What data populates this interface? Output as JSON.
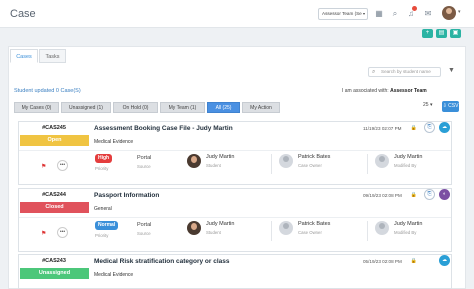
{
  "app": {
    "title": "Case"
  },
  "header": {
    "team_select": "Assessor Team (Se",
    "icons": [
      "calendar-icon",
      "search-icon",
      "bell-icon",
      "chat-icon",
      "avatar"
    ]
  },
  "tabs": [
    {
      "label": "Cases",
      "active": true
    },
    {
      "label": "Tasks",
      "active": false
    }
  ],
  "toolbar": {
    "search_placeholder": "Search by student name"
  },
  "status_line": {
    "updated": "Student updated 0 Case(S)",
    "associated_prefix": "I am associated with:",
    "associated_team": "Assessor Team"
  },
  "filters": [
    {
      "label": "My Cases (0)",
      "active": false
    },
    {
      "label": "Unassigned (1)",
      "active": false
    },
    {
      "label": "On Hold (0)",
      "active": false
    },
    {
      "label": "My Team (1)",
      "active": false
    },
    {
      "label": "All (25)",
      "active": true
    },
    {
      "label": "My Action",
      "active": false
    }
  ],
  "pagination": {
    "page_size": "25",
    "export_label": "CSV"
  },
  "cases": [
    {
      "id": "#CAS245",
      "status": "Open",
      "status_color": "#f0c442",
      "title": "Assessment Booking Case File - Judy Martin",
      "category": "Medical Evidence",
      "date": "11/19/23 02:07 PM",
      "priority": "High",
      "priority_color": "#e43d3d",
      "priority_label": "Priority",
      "source": "Portal",
      "source_label": "Source",
      "student_name": "Judy Martin",
      "student_role": "Student",
      "owner_name": "Patrick Bates",
      "owner_role": "Case Owner",
      "modifier_name": "Judy Martin",
      "modifier_role": "Modified By",
      "badge": "teal"
    },
    {
      "id": "#CAS244",
      "status": "Closed",
      "status_color": "#e0525c",
      "title": "Passport Information",
      "category": "General",
      "date": "09/19/23 02:08 PM",
      "priority": "Normal",
      "priority_color": "#3a8fd9",
      "priority_label": "Priority",
      "source": "Portal",
      "source_label": "Source",
      "student_name": "Judy Martin",
      "student_role": "Student",
      "owner_name": "Patrick Bates",
      "owner_role": "Case Owner",
      "modifier_name": "Judy Martin",
      "modifier_role": "Modified By",
      "badge": "purple"
    },
    {
      "id": "#CAS243",
      "status": "Unassigned",
      "status_color": "#4cc77a",
      "title": "Medical Risk stratification category or class",
      "category": "Medical Evidence",
      "date": "05/19/23 02:08 PM"
    }
  ]
}
